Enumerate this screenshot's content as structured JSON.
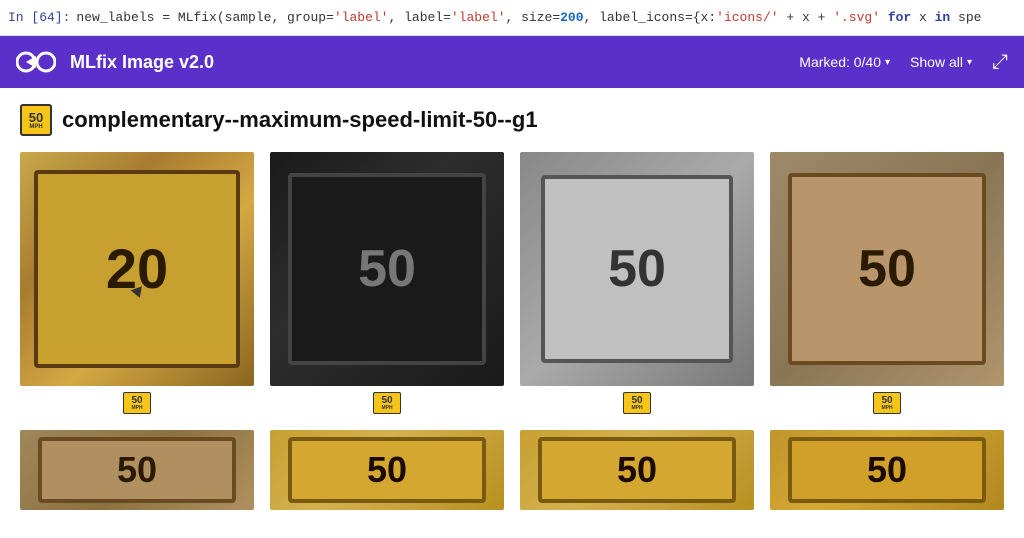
{
  "code_line": {
    "prompt": "In [64]:",
    "content": "new_labels = MLfix(sample, group='label', label='label', size=200, label_icons={x:'icons/' + x + '.svg' for x in spe"
  },
  "toolbar": {
    "logo_text": "MLfix Image v2.0",
    "marked_label": "Marked: 0/40",
    "show_all_label": "Show all",
    "expand_label": "⤢"
  },
  "category": {
    "icon_num": "50",
    "icon_unit": "MPH",
    "label": "complementary--maximum-speed-limit-50--g1"
  },
  "images": [
    {
      "id": "img-1",
      "sign": "20",
      "style": "normal",
      "bg": "tan"
    },
    {
      "id": "img-2",
      "sign": "50",
      "style": "dark",
      "bg": "dark"
    },
    {
      "id": "img-3",
      "sign": "50",
      "style": "gray",
      "bg": "gray"
    },
    {
      "id": "img-4",
      "sign": "50",
      "style": "tan",
      "bg": "tan2"
    },
    {
      "id": "img-5",
      "sign": "50",
      "style": "tan",
      "bg": "tan3"
    },
    {
      "id": "img-6",
      "sign": "50",
      "style": "yellow",
      "bg": "yellow"
    },
    {
      "id": "img-7",
      "sign": "50",
      "style": "yellow",
      "bg": "yellow2"
    },
    {
      "id": "img-8",
      "sign": "50",
      "style": "yellow",
      "bg": "yellow3"
    }
  ],
  "speed_label_num": "50",
  "speed_label_unit": "MPH"
}
